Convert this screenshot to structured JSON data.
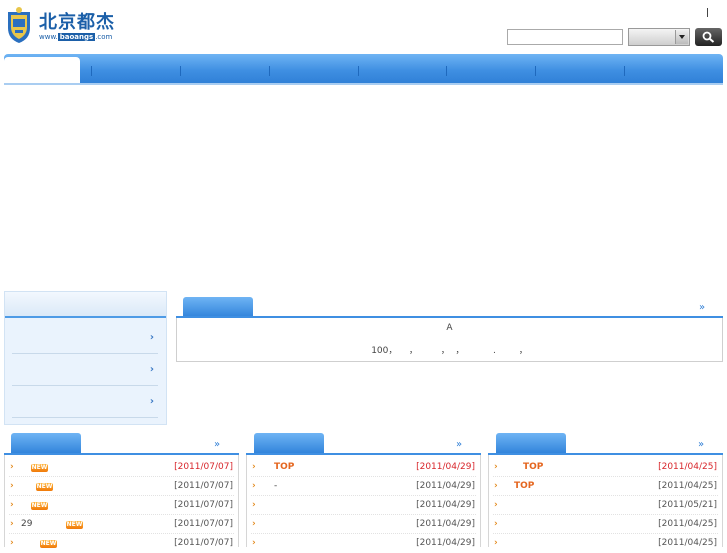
{
  "logo": {
    "name_cn": "北京都杰",
    "url_prefix": "www.",
    "url_highlight": "baoangs",
    "url_suffix": ".com"
  },
  "header": {
    "separator": "|"
  },
  "search": {
    "placeholder": "",
    "select_value": ""
  },
  "nav": {
    "items": [
      "",
      "",
      "",
      "",
      "",
      "",
      "",
      ""
    ]
  },
  "sidebar": {
    "title": "",
    "items": [
      {
        "label": "",
        "arrow": "›"
      },
      {
        "label": "",
        "arrow": "›"
      },
      {
        "label": "",
        "arrow": "›"
      }
    ]
  },
  "notice": {
    "tab_label": "",
    "more": "»",
    "line1": "A",
    "line2": "100，    ，        ，  ，          .        ，"
  },
  "columns": [
    {
      "tab_label": "",
      "more": "»",
      "rows": [
        {
          "bullet": "›",
          "title": "",
          "new": true,
          "date": "[2011/07/07]",
          "date_red": true
        },
        {
          "bullet": "›",
          "title": "",
          "new": true,
          "date": "[2011/07/07]",
          "date_red": false
        },
        {
          "bullet": "›",
          "title": "",
          "new": true,
          "date": "[2011/07/07]",
          "date_red": false
        },
        {
          "bullet": "›",
          "title": "29",
          "new": true,
          "date": "[2011/07/07]",
          "date_red": false
        },
        {
          "bullet": "›",
          "title": "",
          "new": true,
          "date": "[2011/07/07]",
          "date_red": false
        }
      ]
    },
    {
      "tab_label": "",
      "more": "»",
      "rows": [
        {
          "bullet": "›",
          "title": "TOP",
          "top": true,
          "new": false,
          "date": "[2011/04/29]",
          "date_red": true
        },
        {
          "bullet": "›",
          "title": "-",
          "new": false,
          "date": "[2011/04/29]",
          "date_red": false
        },
        {
          "bullet": "›",
          "title": "",
          "new": false,
          "date": "[2011/04/29]",
          "date_red": false
        },
        {
          "bullet": "›",
          "title": "",
          "new": false,
          "date": "[2011/04/29]",
          "date_red": false
        },
        {
          "bullet": "›",
          "title": "",
          "new": false,
          "date": "[2011/04/29]",
          "date_red": false
        }
      ]
    },
    {
      "tab_label": "",
      "more": "»",
      "rows": [
        {
          "bullet": "›",
          "title": "TOP",
          "top": true,
          "new": false,
          "date": "[2011/04/25]",
          "date_red": true
        },
        {
          "bullet": "›",
          "title": "TOP",
          "top": true,
          "new": false,
          "date": "[2011/04/25]",
          "date_red": false
        },
        {
          "bullet": "›",
          "title": "",
          "new": false,
          "date": "[2011/05/21]",
          "date_red": false
        },
        {
          "bullet": "›",
          "title": "",
          "new": false,
          "date": "[2011/04/25]",
          "date_red": false
        },
        {
          "bullet": "›",
          "title": "",
          "new": false,
          "date": "[2011/04/25]",
          "date_red": false
        }
      ]
    }
  ],
  "new_badge_label": "NEW",
  "colors": {
    "nav_blue": "#3f8fe2",
    "accent_orange": "#e38a1d",
    "date_red": "#d8262b"
  }
}
